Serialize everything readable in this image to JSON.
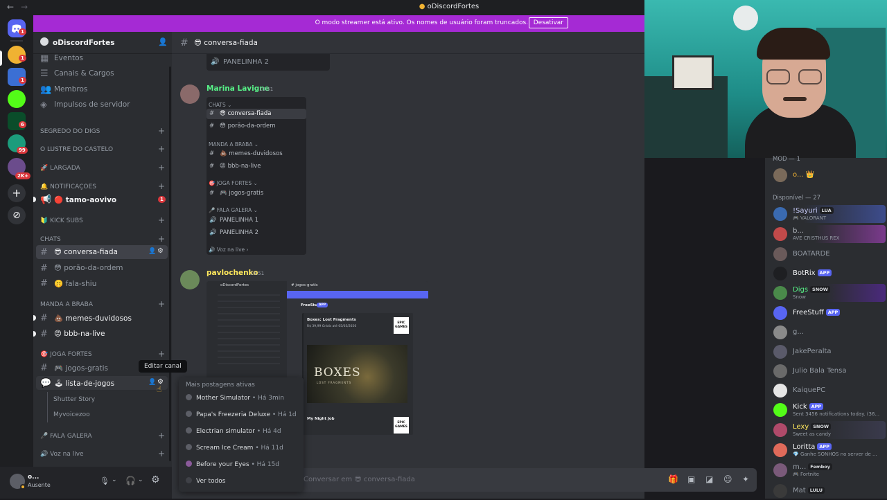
{
  "window": {
    "title": "oDiscordFortes",
    "back": "←",
    "forward": "→"
  },
  "banner": {
    "message": "O modo streamer está ativo. Os nomes de usuário foram truncados.",
    "button": "Desativar"
  },
  "rail": {
    "badges": [
      "1",
      "1",
      "1",
      "6",
      "99",
      "2K+"
    ]
  },
  "server": {
    "name": "oDiscordFortes",
    "menu": [
      "Eventos",
      "Canais & Cargos",
      "Membros",
      "Impulsos de servidor"
    ],
    "sidebar_cats": {
      "segredo": "SEGREDO DO DIGS",
      "lustre": "O LUSTRE DO CASTELO",
      "largada": "🚀 LARGADA",
      "notificacoes": "🔔 NOTIFICAÇOES",
      "kick": "🔰 KICK SUBS",
      "chats": "CHATS",
      "manda": "MANDA A BRABA",
      "joga": "🎯 JOGA FORTES",
      "fala": "🎤 FALA GALERA",
      "voz": "🔊 Voz na live"
    },
    "channels": {
      "tamo": "🔴 tamo-aovivo",
      "tamo_badge": "1",
      "conversa": "😎 conversa-fiada",
      "porao": "😳 porão-da-ordem",
      "fala_shiu": "🤫 fala-shiu",
      "memes": "💩 memes-duvidosos",
      "bbb": "😡 bbb-na-live",
      "jogos_gratis": "🎮 jogos-gratis",
      "lista": "🕹 lista-de-jogos"
    },
    "forum_posts": [
      "Shutter Story",
      "Myvoicezoo"
    ]
  },
  "user_panel": {
    "name": "o...",
    "status": "Ausente"
  },
  "chat": {
    "channel": "😎 conversa-fiada",
    "top_fragment": "PANELINHA 2",
    "messages": [
      {
        "author": "Marina Lavigne",
        "author_color": "#57f287",
        "time": "19:51",
        "embed": {
          "cat1": "CHATS ⌄",
          "ch1": "😎 conversa-fiada",
          "ch2": "😳 porão-da-ordem",
          "cat2": "MANDA A BRABA ⌄",
          "ch3": "💩 memes-duvidosos",
          "ch4": "😡 bbb-na-live",
          "cat3": "🎯 JOGA FORTES ⌄",
          "ch5": "🎮 jogos-gratis",
          "cat4": "🎤 FALA GALERA ⌄",
          "v1": "PANELINHA 1",
          "v2": "PANELINHA 2",
          "cat5": "🔊 Voz na live ›"
        }
      },
      {
        "author": "pavlochenko",
        "author_color": "#fee75c",
        "time": "19:51",
        "image": {
          "server": "oDiscordFortes",
          "channel": "# jogos-gratis",
          "bot": "FreeStuff",
          "bot_tag": "APP",
          "game1": "Boxes: Lost Fragments",
          "game1_price": "R$ 39,99 Grátis até 05/03/2026",
          "game1_art": "BOXES",
          "game1_sub": "LOST FRAGMENTS",
          "game2": "My Night Job",
          "epic": "EPIC GAMES"
        }
      }
    ],
    "composer_placeholder": "Conversar em 😎 conversa-fiada"
  },
  "tooltip": "Editar canal",
  "popup": {
    "title": "Mais postagens ativas",
    "items": [
      {
        "name": "Mother Simulator",
        "ago": "Há 3min"
      },
      {
        "name": "Papa's Freezeria Deluxe",
        "ago": "Há 1d"
      },
      {
        "name": "Electrian simulator",
        "ago": "Há 4d"
      },
      {
        "name": "Scream Ice Cream",
        "ago": "Há 11d"
      },
      {
        "name": "Before your Eyes",
        "ago": "Há 15d"
      }
    ],
    "view_all": "Ver todos"
  },
  "members": {
    "mod_header": "MOD — 1",
    "available_header": "Disponível — 27",
    "list": [
      {
        "name": "o... 👑",
        "status": "",
        "tag": "",
        "color": "#f0b232"
      },
      {
        "name": "!Sayuri",
        "status": "🎮 VALORANT",
        "tag": "LUA",
        "color": "#b5bac1"
      },
      {
        "name": "b...",
        "status": "AVE CRISTHUS REX",
        "tag": "",
        "color": "#b5bac1"
      },
      {
        "name": "BOATARDE",
        "status": "",
        "tag": "",
        "color": "#949ba4"
      },
      {
        "name": "BotRix",
        "status": "",
        "tag": "APP",
        "color": "#f2f3f5"
      },
      {
        "name": "Digs",
        "status": "Snow",
        "tag": "SNOW",
        "color": "#57f287"
      },
      {
        "name": "FreeStuff",
        "status": "",
        "tag": "APP",
        "color": "#f2f3f5"
      },
      {
        "name": "g...",
        "status": "",
        "tag": "",
        "color": "#949ba4"
      },
      {
        "name": "JakePeralta",
        "status": "",
        "tag": "",
        "color": "#949ba4"
      },
      {
        "name": "Julio Bala Tensa",
        "status": "",
        "tag": "",
        "color": "#949ba4"
      },
      {
        "name": "KaiquePC",
        "status": "",
        "tag": "",
        "color": "#949ba4"
      },
      {
        "name": "Kick",
        "status": "Sent 3456 notifications today. (36...",
        "tag": "APP",
        "color": "#f2f3f5"
      },
      {
        "name": "Lexy",
        "status": "Sweet as candy",
        "tag": "SNOW",
        "color": "#fee75c"
      },
      {
        "name": "Loritta",
        "status": "💎 Ganhe SONHOS no server de ...",
        "tag": "APP",
        "color": "#f2f3f5"
      },
      {
        "name": "m...",
        "status": "🎮 Fortnite",
        "tag": "Femboy",
        "color": "#949ba4"
      },
      {
        "name": "Mat",
        "status": "",
        "tag": "LULU",
        "color": "#949ba4"
      }
    ]
  },
  "colors": {
    "accent": "#5865f2",
    "streamer_banner": "#a52ad4",
    "mention": "#da373c",
    "online": "#23a55a"
  }
}
